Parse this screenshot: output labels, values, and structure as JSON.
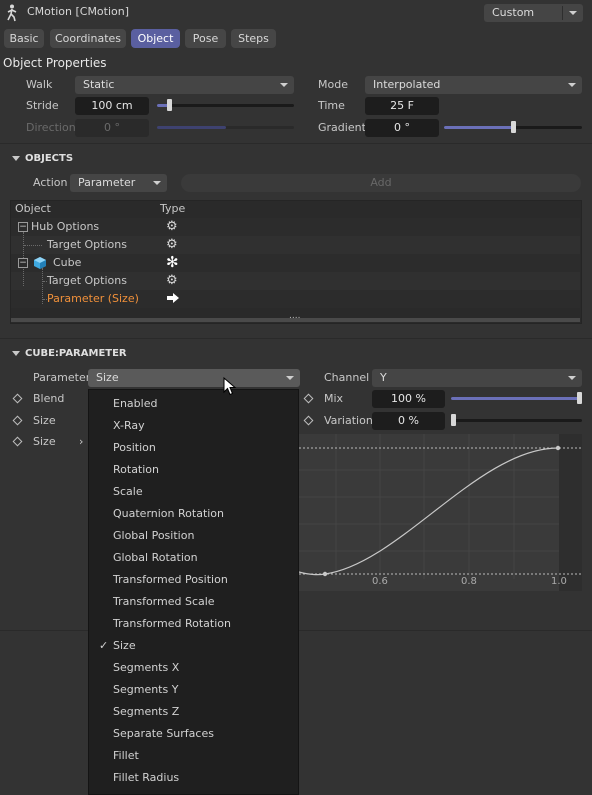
{
  "header": {
    "title": "CMotion [CMotion]",
    "preset": "Custom"
  },
  "tabs": [
    "Basic",
    "Coordinates",
    "Object",
    "Pose",
    "Steps"
  ],
  "active_tab": "Object",
  "object_properties": {
    "title": "Object Properties",
    "walk_label": "Walk",
    "walk_value": "Static",
    "mode_label": "Mode",
    "mode_value": "Interpolated",
    "stride_label": "Stride",
    "stride_value": "100 cm",
    "stride_level": 0.09,
    "time_label": "Time",
    "time_value": "25 F",
    "direction_label": "Direction",
    "direction_value": "0 °",
    "direction_level": 0.5,
    "gradient_label": "Gradient",
    "gradient_value": "0 °",
    "gradient_level": 0.5
  },
  "objects": {
    "title": "OBJECTS",
    "action_label": "Action",
    "action_value": "Parameter",
    "add_label": "Add",
    "col_object": "Object",
    "col_type": "Type",
    "rows": [
      {
        "name": "Hub Options",
        "icon": "gear-icon"
      },
      {
        "name": "Target Options",
        "icon": "gear-icon"
      },
      {
        "name": "Cube",
        "icon": "asterisk-icon"
      },
      {
        "name": "Target Options",
        "icon": "gear-icon"
      },
      {
        "name": "Parameter (Size)",
        "icon": "arrow-right-icon"
      }
    ],
    "handle": "....",
    "highlight_color": "#f0903a"
  },
  "cube_parameter": {
    "title": "CUBE:PARAMETER",
    "parameter_label": "Parameter",
    "parameter_value": "Size",
    "channel_label": "Channel",
    "channel_value": "Y",
    "blend_label": "Blend",
    "mix_label": "Mix",
    "mix_value": "100 %",
    "mix_level": 1.0,
    "size_label": "Size",
    "variation_label": "Variation",
    "variation_value": "0 %",
    "variation_level": 0.0,
    "size_label_2": "Size",
    "graph_ticks": [
      "0.6",
      "0.8",
      "1.0"
    ]
  },
  "dropdown_menu": {
    "items": [
      "Enabled",
      "X-Ray",
      "Position",
      "Rotation",
      "Scale",
      "Quaternion Rotation",
      "Global Position",
      "Global Rotation",
      "Transformed Position",
      "Transformed Scale",
      "Transformed Rotation",
      "Size",
      "Segments X",
      "Segments Y",
      "Segments Z",
      "Separate Surfaces",
      "Fillet",
      "Fillet Radius"
    ],
    "checked": "Size",
    "check_mark": "✓"
  },
  "colors": {
    "accent": "#5a5fa0",
    "slider_fill": "#6b70b8",
    "background": "#333333"
  }
}
